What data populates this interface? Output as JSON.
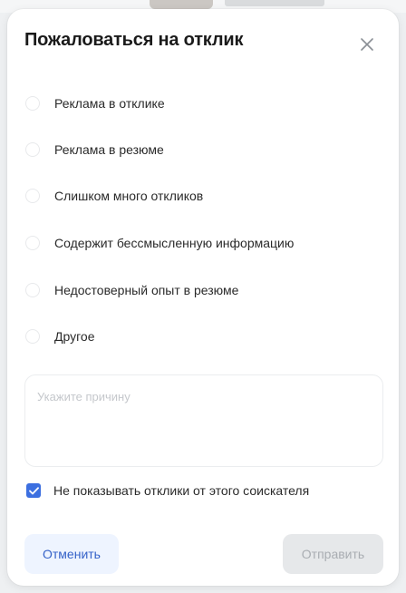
{
  "dialog": {
    "title": "Пожаловаться на отклик",
    "close_icon": "close-icon"
  },
  "reasons": [
    {
      "label": "Реклама в отклике",
      "selected": false
    },
    {
      "label": "Реклама в резюме",
      "selected": false
    },
    {
      "label": "Слишком много откликов",
      "selected": false
    },
    {
      "label": "Содержит бессмысленную информацию",
      "selected": false
    },
    {
      "label": "Недостоверный опыт в резюме",
      "selected": false
    },
    {
      "label": "Другое",
      "selected": false
    }
  ],
  "reason_input": {
    "placeholder": "Укажите причину",
    "value": ""
  },
  "hide_responses": {
    "label": "Не показывать отклики от этого соискателя",
    "checked": true
  },
  "buttons": {
    "cancel_label": "Отменить",
    "submit_label": "Отправить",
    "submit_disabled": true
  },
  "colors": {
    "accent": "#3c6fe0",
    "cancel_bg": "#eef4ff",
    "cancel_text": "#3562c8",
    "submit_disabled_bg": "#e6e8ea",
    "submit_disabled_text": "#a9adb2"
  }
}
